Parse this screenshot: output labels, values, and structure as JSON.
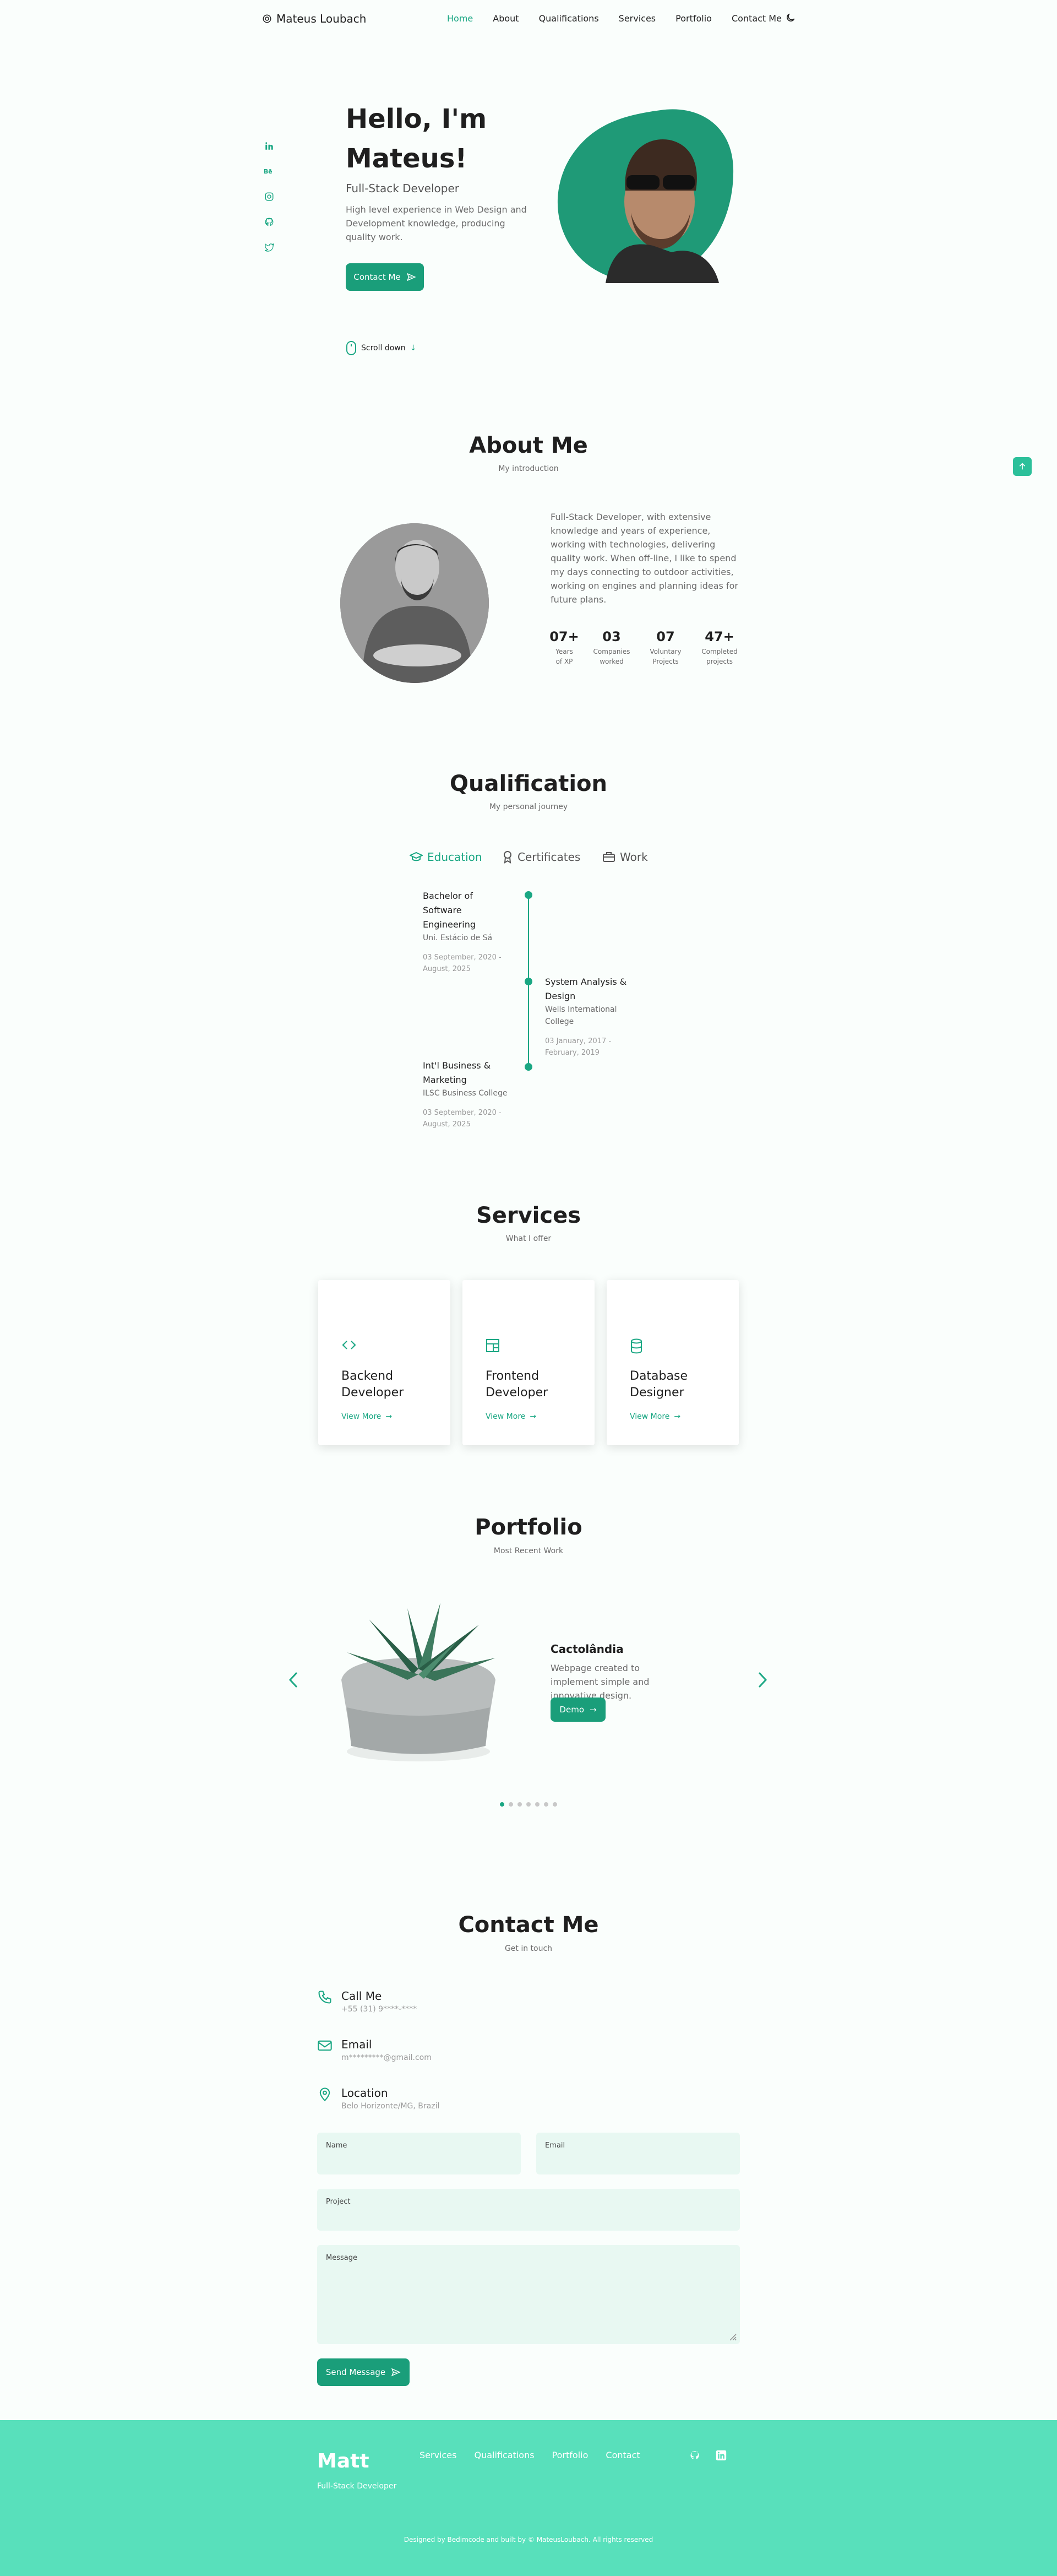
{
  "nav": {
    "brand": "Mateus Loubach",
    "links": [
      "Home",
      "About",
      "Qualifications",
      "Services",
      "Portfolio",
      "Contact Me"
    ],
    "active_color": "#1aa783"
  },
  "hero": {
    "title": "Hello, I'm Mateus!",
    "subtitle": "Full-Stack Developer",
    "description": "High level experience in Web Design and Development knowledge, producing quality work.",
    "cta": "Contact Me",
    "scroll": "Scroll down",
    "socials": [
      "linkedin-icon",
      "behance-icon",
      "instagram-icon",
      "github-icon",
      "twitter-icon"
    ]
  },
  "about": {
    "title": "About Me",
    "subtitle": "My introduction",
    "description": "Full-Stack Developer, with extensive knowledge and years of experience, working with technologies, delivering quality work. When off-line, I like to spend my days connecting to outdoor activities, working on engines and planning ideas for future plans.",
    "stats": [
      {
        "num": "07+",
        "label": "Years of XP"
      },
      {
        "num": "03",
        "label": "Companies worked"
      },
      {
        "num": "07",
        "label": "Voluntary Projects"
      },
      {
        "num": "47+",
        "label": "Completed projects"
      }
    ]
  },
  "qualification": {
    "title": "Qualification",
    "subtitle": "My personal journey",
    "tabs": [
      "Education",
      "Certificates",
      "Work"
    ],
    "items": [
      {
        "title": "Bachelor of Software Engineering",
        "school": "Uni. Estácio de Sá",
        "date": "03 September, 2020 - August, 2025"
      },
      {
        "title": "System Analysis & Design",
        "school": "Wells International College",
        "date": "03 January, 2017 - February, 2019"
      },
      {
        "title": "Int'l Business & Marketing",
        "school": "ILSC Business College",
        "date": "03 September, 2020 - August, 2025"
      }
    ]
  },
  "services": {
    "title": "Services",
    "subtitle": "What I offer",
    "cards": [
      {
        "title": "Backend Developer",
        "link": "View More",
        "icon": "code-icon"
      },
      {
        "title": "Frontend Developer",
        "link": "View More",
        "icon": "layout-icon"
      },
      {
        "title": "Database Designer",
        "link": "View More",
        "icon": "database-icon"
      }
    ]
  },
  "portfolio": {
    "title": "Portfolio",
    "subtitle": "Most Recent Work",
    "project_title": "Cactolândia",
    "project_desc": "Webpage created to implement simple and innovative design.",
    "demo": "Demo"
  },
  "contact": {
    "title": "Contact Me",
    "subtitle": "Get in touch",
    "items": [
      {
        "title": "Call Me",
        "value": "+55 (31) 9****-****",
        "icon": "phone-icon"
      },
      {
        "title": "Email",
        "value": "m*********@gmail.com",
        "icon": "mail-icon"
      },
      {
        "title": "Location",
        "value": "Belo Horizonte/MG, Brazil",
        "icon": "location-pin-icon"
      }
    ],
    "fields": {
      "name": "Name",
      "email": "Email",
      "project": "Project",
      "message": "Message"
    },
    "send": "Send Message"
  },
  "footer": {
    "brand": "Matt",
    "role": "Full-Stack Developer",
    "links": [
      "Services",
      "Qualifications",
      "Portfolio",
      "Contact"
    ],
    "copyright": "Designed by Bedimcode and built by © MateusLoubach. All rights reserved"
  }
}
